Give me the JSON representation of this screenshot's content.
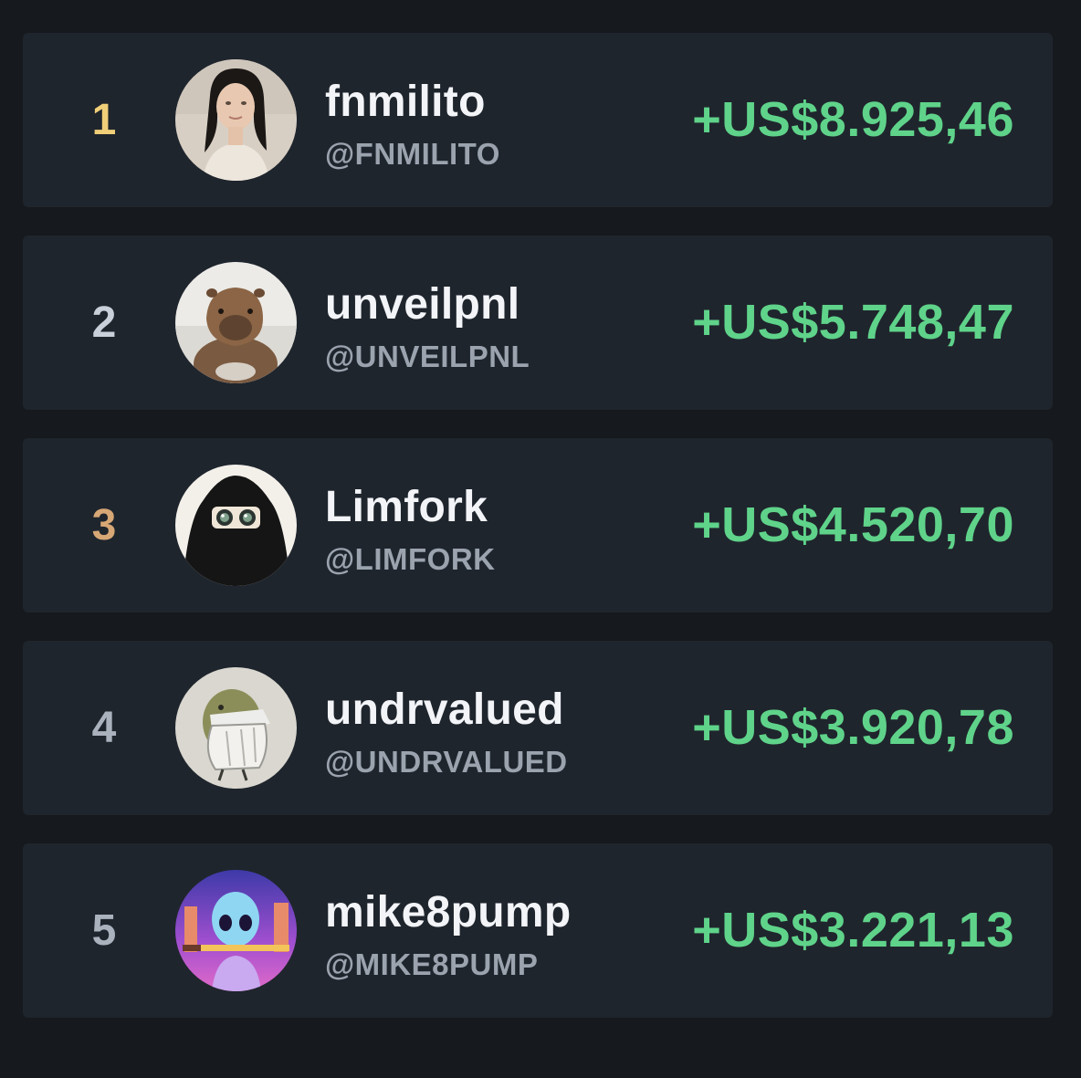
{
  "leaderboard": {
    "accent_color": "#5fd38a",
    "rank_colors": {
      "gold": "#f0cf78",
      "silver": "#c9d0d9",
      "bronze": "#d7a775",
      "default": "#aab2bd"
    },
    "entries": [
      {
        "rank": "1",
        "name": "fnmilito",
        "handle": "@FNMILITO",
        "pnl": "+US$8.925,46",
        "avatar_icon": "portrait-avatar"
      },
      {
        "rank": "2",
        "name": "unveilpnl",
        "handle": "@UNVEILPNL",
        "pnl": "+US$5.748,47",
        "avatar_icon": "capybara-avatar"
      },
      {
        "rank": "3",
        "name": "Limfork",
        "handle": "@LIMFORK",
        "pnl": "+US$4.520,70",
        "avatar_icon": "veiled-character-avatar"
      },
      {
        "rank": "4",
        "name": "undrvalued",
        "handle": "@UNDRVALUED",
        "pnl": "+US$3.920,78",
        "avatar_icon": "bird-cloak-avatar"
      },
      {
        "rank": "5",
        "name": "mike8pump",
        "handle": "@MIKE8PUMP",
        "pnl": "+US$3.221,13",
        "avatar_icon": "alien-warrior-avatar"
      }
    ]
  }
}
